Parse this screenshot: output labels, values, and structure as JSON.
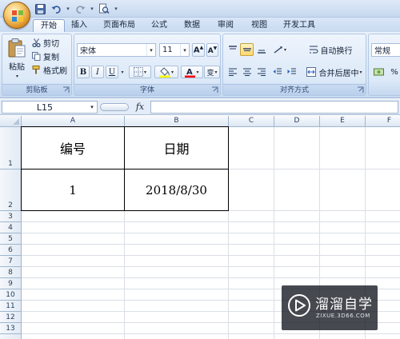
{
  "quick_access": {
    "save_icon": "save-icon",
    "undo_icon": "undo-icon",
    "redo_icon": "redo-icon",
    "print_preview_icon": "print-preview-icon"
  },
  "tabs": [
    "开始",
    "插入",
    "页面布局",
    "公式",
    "数据",
    "审阅",
    "视图",
    "开发工具"
  ],
  "ribbon": {
    "clipboard": {
      "paste": "粘贴",
      "cut": "剪切",
      "copy": "复制",
      "format_painter": "格式刷",
      "label": "剪贴板"
    },
    "font": {
      "name": "宋体",
      "size": "11",
      "bold": "B",
      "italic": "I",
      "underline": "U",
      "fill_color": "#ffff00",
      "font_color": "#ff0000",
      "pinyin": "变",
      "label": "字体"
    },
    "alignment": {
      "wrap_text": "自动换行",
      "merge_center": "合并后居中",
      "label": "对齐方式"
    },
    "number": {
      "format": "常规"
    }
  },
  "formula_bar": {
    "name_box": "L15",
    "fx": "fx",
    "formula": ""
  },
  "sheet": {
    "columns": [
      "A",
      "B",
      "C",
      "D",
      "E",
      "F"
    ],
    "rows": [
      "1",
      "2",
      "3",
      "4",
      "5",
      "6",
      "7",
      "8",
      "9",
      "10",
      "11",
      "12",
      "13"
    ],
    "cells": {
      "A1": "编号",
      "B1": "日期",
      "A2": "1",
      "B2": "2018/8/30"
    }
  },
  "watermark": {
    "name": "溜溜自学",
    "url": "ZIXUE.3D66.COM"
  }
}
